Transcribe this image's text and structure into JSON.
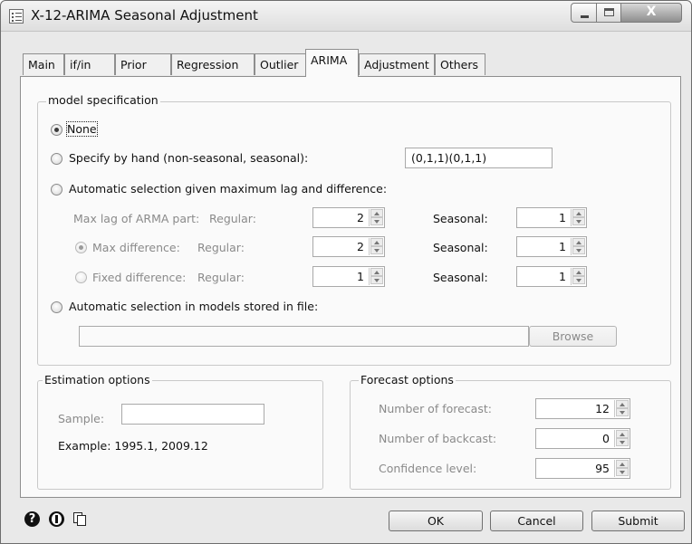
{
  "window": {
    "title": "X-12-ARIMA Seasonal Adjustment",
    "close_glyph": "X"
  },
  "tabs": [
    "Main",
    "if/in",
    "Prior",
    "Regression",
    "Outlier",
    "ARIMA",
    "Adjustment",
    "Others"
  ],
  "active_tab": "ARIMA",
  "model_spec": {
    "legend": "model specification",
    "none_label": "None",
    "by_hand_label": "Specify by hand (non-seasonal, seasonal):",
    "by_hand_value": "(0,1,1)(0,1,1)",
    "auto_label": "Automatic selection given maximum lag and difference:",
    "maxlag_label": "Max lag of ARMA part:",
    "regular_label": "Regular:",
    "seasonal_label": "Seasonal:",
    "maxlag_regular": "2",
    "maxlag_seasonal": "1",
    "maxdiff_label": "Max difference:",
    "maxdiff_regular": "2",
    "maxdiff_seasonal": "1",
    "fixeddiff_label": "Fixed difference:",
    "fixeddiff_regular": "1",
    "fixeddiff_seasonal": "1",
    "file_label": "Automatic selection in models stored in file:",
    "file_value": "",
    "browse_label": "Browse"
  },
  "estimation": {
    "legend": "Estimation options",
    "sample_label": "Sample:",
    "sample_value": "",
    "example": "Example: 1995.1, 2009.12"
  },
  "forecast": {
    "legend": "Forecast options",
    "nforecast_label": "Number of forecast:",
    "nforecast": "12",
    "nbackcast_label": "Number of backcast:",
    "nbackcast": "0",
    "conf_label": "Confidence level:",
    "conf": "95"
  },
  "buttons": {
    "ok": "OK",
    "cancel": "Cancel",
    "submit": "Submit"
  },
  "icons": [
    "help-icon",
    "info-icon",
    "copy-icon"
  ]
}
